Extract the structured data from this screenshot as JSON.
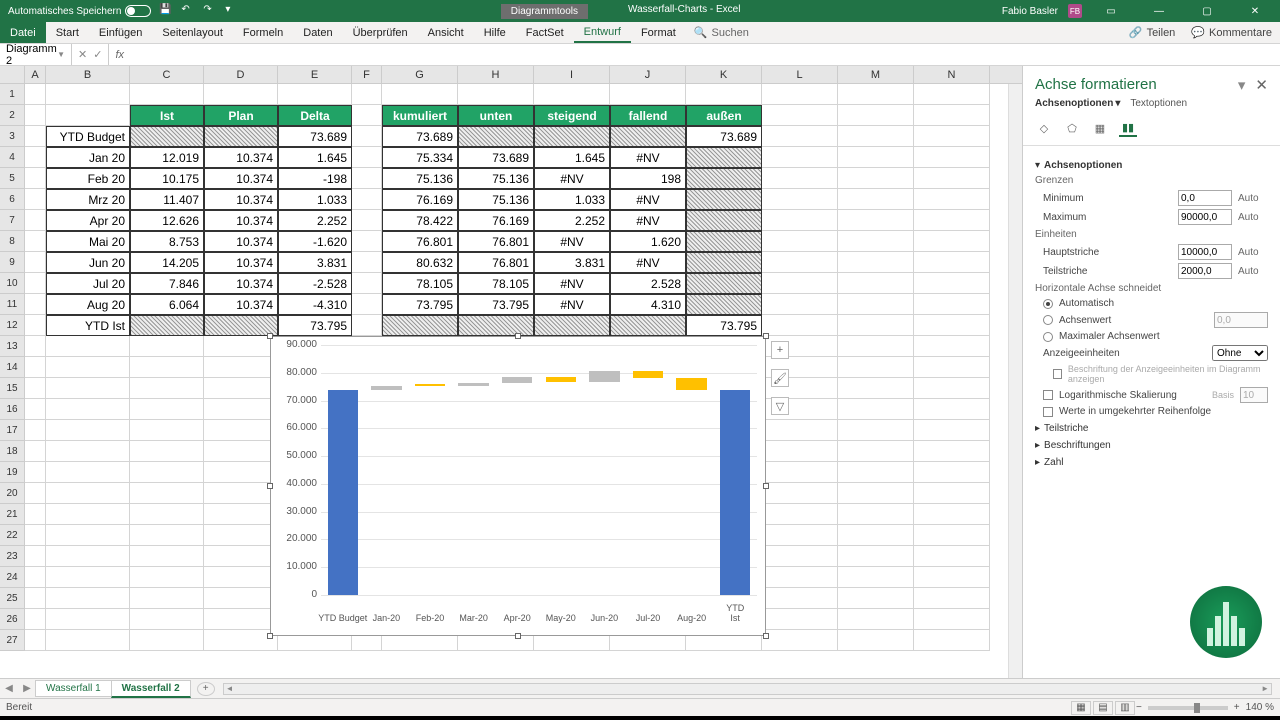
{
  "titlebar": {
    "autosave": "Automatisches Speichern",
    "context_tool": "Diagrammtools",
    "doc_title": "Wasserfall-Charts - Excel",
    "user": "Fabio Basler",
    "user_initials": "FB"
  },
  "ribbon": {
    "tabs": [
      "Datei",
      "Start",
      "Einfügen",
      "Seitenlayout",
      "Formeln",
      "Daten",
      "Überprüfen",
      "Ansicht",
      "Hilfe",
      "FactSet",
      "Entwurf",
      "Format"
    ],
    "search": "Suchen",
    "share": "Teilen",
    "comments": "Kommentare"
  },
  "namebox": "Diagramm 2",
  "columns": [
    "A",
    "B",
    "C",
    "D",
    "E",
    "F",
    "G",
    "H",
    "I",
    "J",
    "K",
    "L",
    "M",
    "N"
  ],
  "row_numbers": [
    1,
    2,
    3,
    4,
    5,
    6,
    7,
    8,
    9,
    10,
    11,
    12,
    13,
    14,
    15,
    16,
    17,
    18,
    19,
    20,
    21,
    22,
    23,
    24,
    25,
    26,
    27
  ],
  "table1": {
    "headers": [
      "Ist",
      "Plan",
      "Delta"
    ],
    "row_labels": [
      "YTD Budget",
      "Jan 20",
      "Feb 20",
      "Mrz 20",
      "Apr 20",
      "Mai 20",
      "Jun 20",
      "Jul 20",
      "Aug 20",
      "YTD Ist"
    ],
    "ist": [
      "",
      "12.019",
      "10.175",
      "11.407",
      "12.626",
      "8.753",
      "14.205",
      "7.846",
      "6.064",
      ""
    ],
    "plan": [
      "",
      "10.374",
      "10.374",
      "10.374",
      "10.374",
      "10.374",
      "10.374",
      "10.374",
      "10.374",
      ""
    ],
    "delta": [
      "73.689",
      "1.645",
      "-198",
      "1.033",
      "2.252",
      "-1.620",
      "3.831",
      "-2.528",
      "-4.310",
      "73.795"
    ]
  },
  "table2": {
    "headers": [
      "kumuliert",
      "unten",
      "steigend",
      "fallend",
      "außen"
    ],
    "kumuliert": [
      "73.689",
      "75.334",
      "75.136",
      "76.169",
      "78.422",
      "76.801",
      "80.632",
      "78.105",
      "73.795",
      ""
    ],
    "unten": [
      "",
      "73.689",
      "75.136",
      "75.136",
      "76.169",
      "76.801",
      "76.801",
      "78.105",
      "73.795",
      ""
    ],
    "steigend": [
      "",
      "1.645",
      "#NV",
      "1.033",
      "2.252",
      "#NV",
      "3.831",
      "#NV",
      "#NV",
      ""
    ],
    "fallend": [
      "",
      "#NV",
      "198",
      "#NV",
      "#NV",
      "1.620",
      "#NV",
      "2.528",
      "4.310",
      ""
    ],
    "aussen": [
      "73.689",
      "",
      "",
      "",
      "",
      "",
      "",
      "",
      "",
      "73.795"
    ]
  },
  "chart_data": {
    "type": "bar",
    "categories": [
      "YTD Budget",
      "Jan-20",
      "Feb-20",
      "Mar-20",
      "Apr-20",
      "May-20",
      "Jun-20",
      "Jul-20",
      "Aug-20",
      "YTD Ist"
    ],
    "series": [
      {
        "name": "unten",
        "color": "transparent",
        "values": [
          0,
          73689,
          75136,
          75136,
          76169,
          76801,
          76801,
          78105,
          73795,
          0
        ]
      },
      {
        "name": "steigend",
        "color": "#bfbfbf",
        "values": [
          0,
          1645,
          0,
          1033,
          2252,
          0,
          3831,
          0,
          0,
          0
        ]
      },
      {
        "name": "fallend",
        "color": "#ffc000",
        "values": [
          0,
          0,
          198,
          0,
          0,
          1620,
          0,
          2528,
          4310,
          0
        ]
      },
      {
        "name": "außen",
        "color": "#4472c4",
        "values": [
          73689,
          0,
          0,
          0,
          0,
          0,
          0,
          0,
          0,
          73795
        ]
      }
    ],
    "ylabel": "",
    "xlabel": "",
    "ylim": [
      0,
      90000
    ],
    "yticks": [
      "0",
      "10.000",
      "20.000",
      "30.000",
      "40.000",
      "50.000",
      "60.000",
      "70.000",
      "80.000",
      "90.000"
    ]
  },
  "pane": {
    "title": "Achse formatieren",
    "opt_tab": "Achsenoptionen",
    "text_tab": "Textoptionen",
    "sec_axis": "Achsenoptionen",
    "grenzen": "Grenzen",
    "min": "Minimum",
    "min_val": "0,0",
    "max": "Maximum",
    "max_val": "90000,0",
    "auto": "Auto",
    "einheiten": "Einheiten",
    "haupt": "Hauptstriche",
    "haupt_val": "10000,0",
    "teil": "Teilstriche",
    "teil_val": "2000,0",
    "horiz": "Horizontale Achse schneidet",
    "r1": "Automatisch",
    "r2": "Achsenwert",
    "r2_val": "0,0",
    "r3": "Maximaler Achsenwert",
    "anzeige": "Anzeigeeinheiten",
    "anzeige_val": "Ohne",
    "anzeige_chk": "Beschriftung der Anzeigeeinheiten im Diagramm anzeigen",
    "log": "Logarithmische Skalierung",
    "basis": "Basis",
    "basis_val": "10",
    "rev": "Werte in umgekehrter Reihenfolge",
    "teilstriche": "Teilstriche",
    "beschriftungen": "Beschriftungen",
    "zahl": "Zahl"
  },
  "tabs": {
    "s1": "Wasserfall 1",
    "s2": "Wasserfall 2"
  },
  "status": {
    "ready": "Bereit",
    "zoom": "140 %"
  }
}
